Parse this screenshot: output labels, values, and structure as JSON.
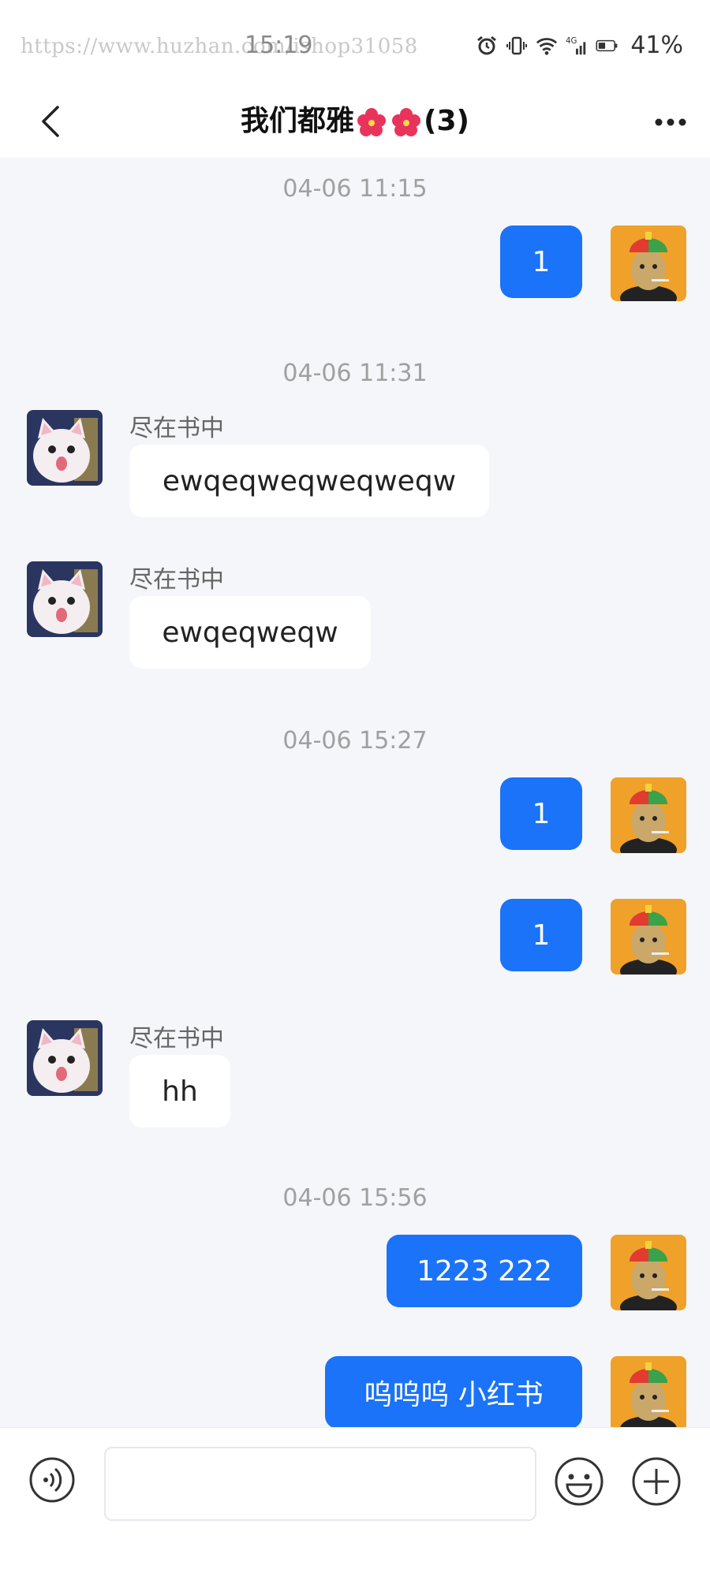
{
  "status_bar": {
    "watermark": "https://www.huzhan.com/ishop31058",
    "time": "15:19",
    "battery": "41%",
    "icons": [
      "alarm-icon",
      "vibrate-icon",
      "wifi-icon",
      "4g-icon",
      "signal-icon",
      "battery-icon"
    ]
  },
  "header": {
    "title_prefix": "我们都雅",
    "title_suffix": "(3)",
    "back_icon": "chevron-left-icon",
    "more_icon": "more-horizontal-icon"
  },
  "messages": [
    {
      "type": "timestamp",
      "text": "04-06 11:15"
    },
    {
      "type": "out",
      "text": "1"
    },
    {
      "type": "timestamp",
      "text": "04-06 11:31"
    },
    {
      "type": "in",
      "sender": "尽在书中",
      "text": "ewqeqweqweqweqw"
    },
    {
      "type": "in",
      "sender": "尽在书中",
      "text": "ewqeqweqw"
    },
    {
      "type": "timestamp",
      "text": "04-06 15:27"
    },
    {
      "type": "out",
      "text": "1"
    },
    {
      "type": "out",
      "text": "1"
    },
    {
      "type": "in",
      "sender": "尽在书中",
      "text": "hh"
    },
    {
      "type": "timestamp",
      "text": "04-06 15:56"
    },
    {
      "type": "out",
      "text": "1223 222"
    },
    {
      "type": "out",
      "text": "呜呜呜 小红书"
    }
  ],
  "input_bar": {
    "voice_icon": "voice-icon",
    "input_value": "",
    "emoji_icon": "emoji-icon",
    "plus_icon": "plus-icon"
  },
  "colors": {
    "accent": "#1a73f8",
    "background": "#f5f6fa",
    "timestamp": "#a0a0a0"
  }
}
